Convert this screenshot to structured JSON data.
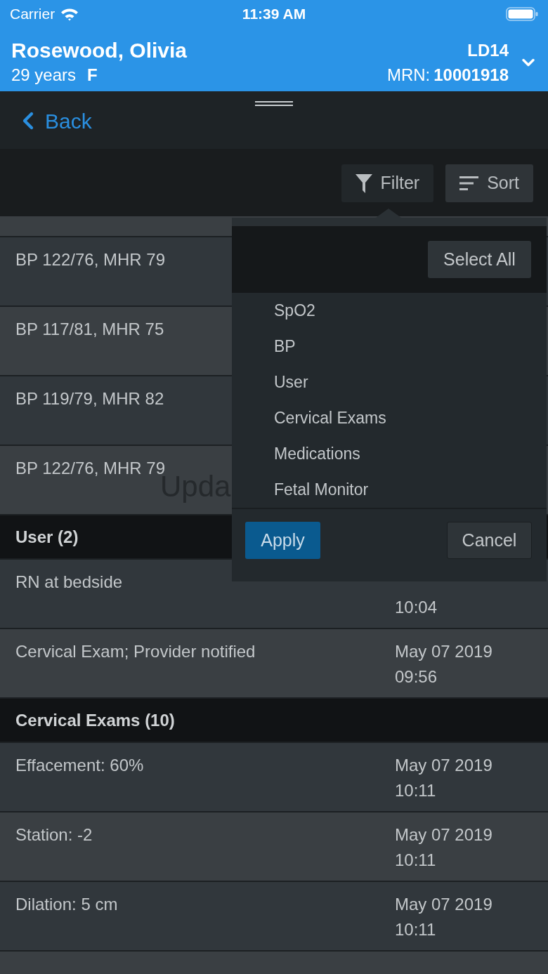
{
  "status_bar": {
    "carrier": "Carrier",
    "time": "11:39 AM"
  },
  "patient": {
    "name": "Rosewood, Olivia",
    "age": "29 years",
    "sex": "F",
    "location": "LD14",
    "mrn_label": "MRN:",
    "mrn": "10001918"
  },
  "nav": {
    "back": "Back"
  },
  "toolbar": {
    "buttons": [
      {
        "kind": "filter",
        "label": "Filter",
        "active": true
      },
      {
        "kind": "sort",
        "label": "Sort",
        "active": false
      }
    ]
  },
  "sections": [
    {
      "rows": [
        {
          "text": "BP 122/76, MHR 79"
        },
        {
          "text": "BP 117/81, MHR 75"
        },
        {
          "text": "BP 119/79, MHR 82"
        },
        {
          "text": "BP 122/76, MHR 79"
        }
      ]
    },
    {
      "header": "User (2)",
      "rows": [
        {
          "text": "RN at bedside",
          "time": "10:04"
        },
        {
          "text": "Cervical Exam; Provider notified",
          "date": "May 07 2019",
          "time": "09:56"
        }
      ]
    },
    {
      "header": "Cervical Exams (10)",
      "rows": [
        {
          "text": "Effacement: 60%",
          "date": "May 07 2019",
          "time": "10:11"
        },
        {
          "text": "Station: -2",
          "date": "May 07 2019",
          "time": "10:11"
        },
        {
          "text": "Dilation: 5 cm",
          "date": "May 07 2019",
          "time": "10:11"
        }
      ]
    }
  ],
  "overlay_text": "Upda",
  "filter_popup": {
    "select_all": "Select All",
    "options": [
      "SpO2",
      "BP",
      "User",
      "Cervical Exams",
      "Medications",
      "Fetal Monitor"
    ],
    "apply": "Apply",
    "cancel": "Cancel"
  }
}
